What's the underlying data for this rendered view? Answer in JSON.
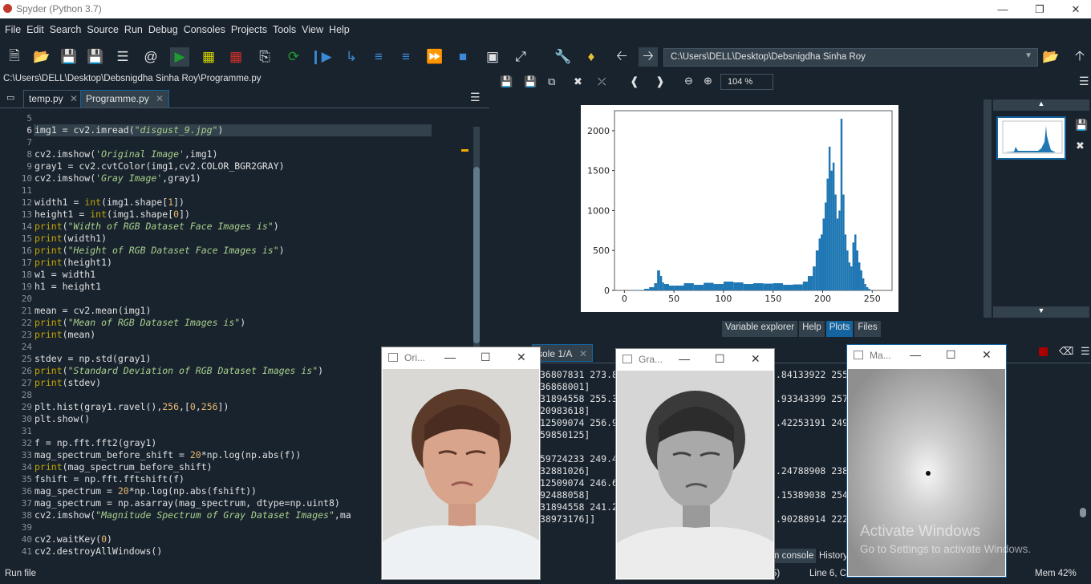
{
  "window": {
    "title": "Spyder (Python 3.7)"
  },
  "menu": [
    "File",
    "Edit",
    "Search",
    "Source",
    "Run",
    "Debug",
    "Consoles",
    "Projects",
    "Tools",
    "View",
    "Help"
  ],
  "toolbar": {
    "path": "C:\\Users\\DELL\\Desktop\\Debsnigdha Sinha Roy"
  },
  "editor": {
    "path": "C:\\Users\\DELL\\Desktop\\Debsnigdha Sinha Roy\\Programme.py",
    "tabs": [
      "temp.py",
      "Programme.py"
    ],
    "line_numbers": [
      "5",
      "6",
      "7",
      "8",
      "9",
      "10",
      "11",
      "12",
      "13",
      "14",
      "15",
      "16",
      "17",
      "18",
      "19",
      "20",
      "21",
      "22",
      "23",
      "24",
      "25",
      "26",
      "27",
      "28",
      "29",
      "30",
      "31",
      "32",
      "33",
      "34",
      "35",
      "36",
      "37",
      "38",
      "39",
      "40",
      "41"
    ]
  },
  "plots": {
    "zoom": "104 %",
    "tabs": [
      "Variable explorer",
      "Help",
      "Plots",
      "Files"
    ],
    "active_tab": "Plots"
  },
  "chart_data": {
    "type": "bar",
    "title": "",
    "xlabel": "",
    "ylabel": "",
    "xlim": [
      -10,
      270
    ],
    "ylim": [
      0,
      2250
    ],
    "xticks": [
      "0",
      "50",
      "100",
      "150",
      "200",
      "250"
    ],
    "yticks": [
      "0",
      "500",
      "1000",
      "1500",
      "2000"
    ],
    "series_color": "#1f77b4",
    "x": [
      0,
      10,
      20,
      25,
      30,
      33,
      36,
      38,
      40,
      45,
      50,
      60,
      70,
      80,
      90,
      100,
      110,
      120,
      130,
      140,
      150,
      160,
      170,
      180,
      185,
      190,
      193,
      196,
      198,
      200,
      202,
      204,
      206,
      208,
      210,
      212,
      214,
      216,
      218,
      220,
      222,
      224,
      226,
      228,
      230,
      232,
      234,
      236,
      238,
      240,
      242,
      244,
      246,
      248,
      250,
      255
    ],
    "values": [
      0,
      5,
      20,
      40,
      90,
      250,
      180,
      100,
      80,
      60,
      60,
      90,
      70,
      95,
      80,
      110,
      100,
      80,
      90,
      85,
      90,
      70,
      75,
      110,
      180,
      300,
      500,
      650,
      700,
      900,
      1100,
      1400,
      1800,
      1500,
      1600,
      1200,
      900,
      1000,
      2150,
      1200,
      700,
      500,
      350,
      300,
      600,
      700,
      500,
      350,
      250,
      150,
      80,
      40,
      20,
      5,
      0,
      0
    ]
  },
  "console": {
    "tab": "sole 1/A",
    "lines_left": [
      "36807831 273.8",
      "36868001]",
      "31894558 255.3",
      "20983618]",
      "12509074 256.9",
      "59850125]",
      "",
      "59724233 249.4",
      "32881026]",
      "12509074 246.6",
      "92488058]",
      "31894558 241.2",
      "38973176]]"
    ],
    "lines_right": [
      ".84133922 255",
      ".93343399 257",
      ".42253191 249",
      ".24788908 238",
      ".15389038 254",
      ".90288914 222"
    ],
    "bottom_tabs": [
      "n console",
      "History"
    ]
  },
  "windows": [
    {
      "title": "Ori..."
    },
    {
      "title": "Gra..."
    },
    {
      "title": "Ma..."
    }
  ],
  "watermark": {
    "line1": "Activate Windows",
    "line2": "Go to Settings to activate Windows."
  },
  "status": {
    "left": "Run file",
    "middle_a": "5)",
    "middle_b": "Line 6, Co",
    "mem": "Mem 42%"
  }
}
